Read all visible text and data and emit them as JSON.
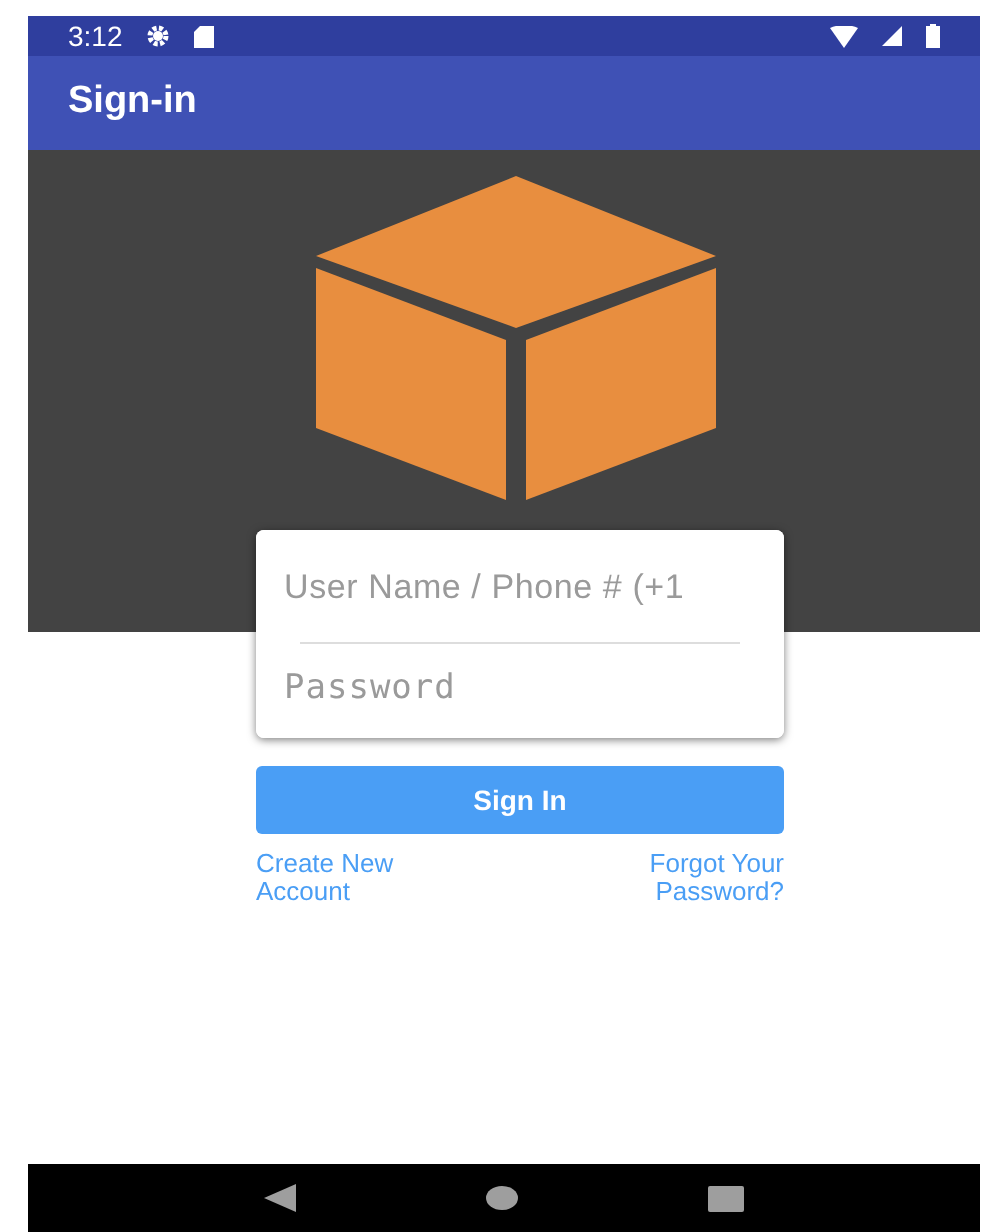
{
  "status_bar": {
    "time": "3:12"
  },
  "app_bar": {
    "title": "Sign-in"
  },
  "form": {
    "username": {
      "placeholder": "User Name / Phone # (+1"
    },
    "password": {
      "placeholder": "Password"
    }
  },
  "sign_in_button": "Sign In",
  "links": [
    "Create New\nAccount",
    "Forgot Your\nPassword?"
  ]
}
